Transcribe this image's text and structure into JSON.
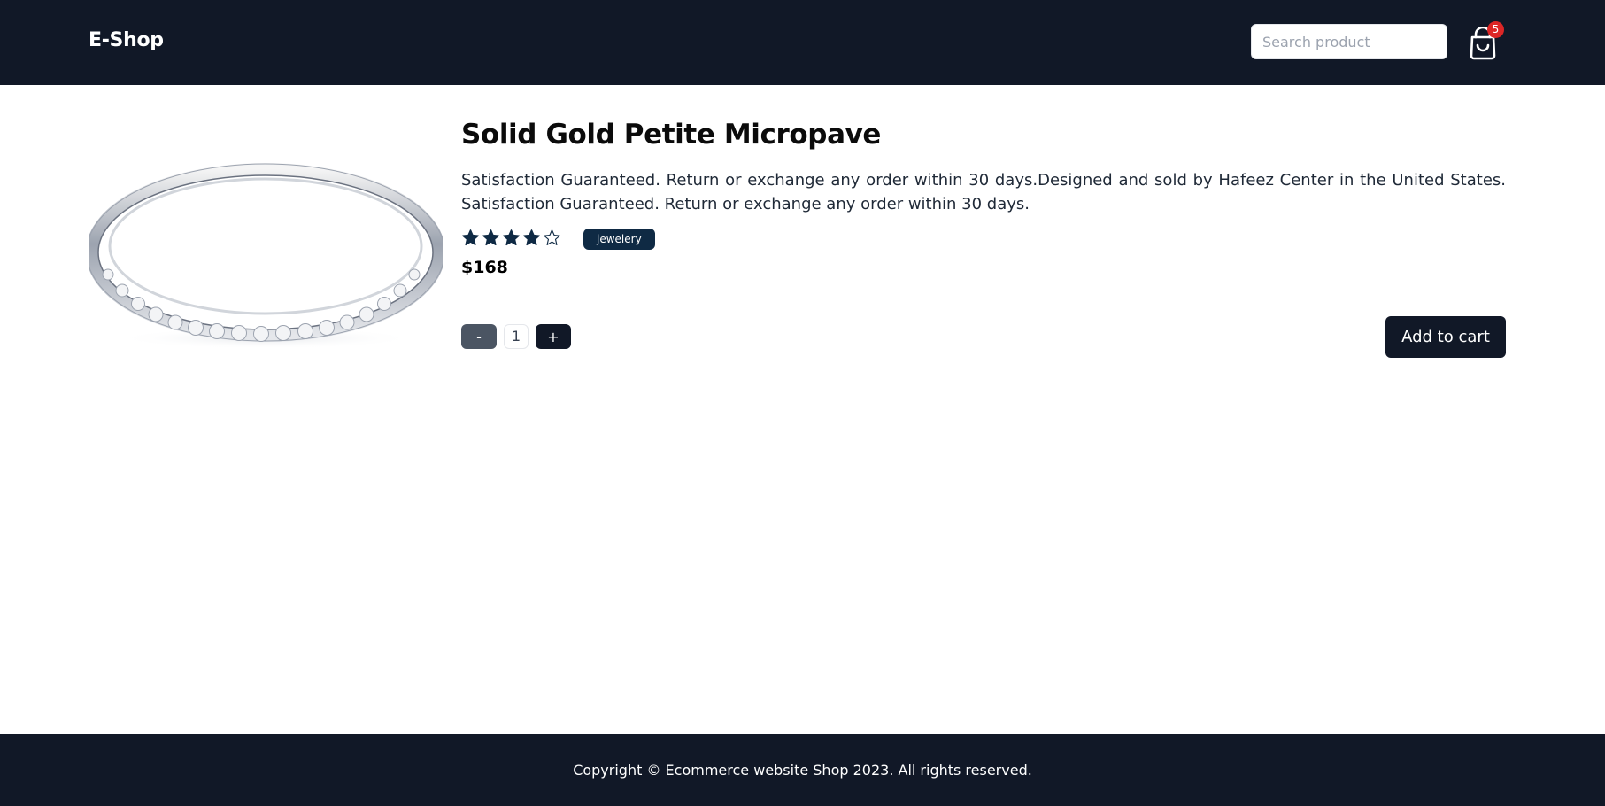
{
  "header": {
    "logo": "E-Shop",
    "search_placeholder": "Search product",
    "cart_count": "5",
    "cart_icon": "shopping-bag-icon"
  },
  "product": {
    "title": "Solid Gold Petite Micropave",
    "description": "Satisfaction Guaranteed. Return or exchange any order within 30 days.Designed and sold by Hafeez Center in the United States. Satisfaction Guaranteed. Return or exchange any order within 30 days.",
    "rating": {
      "filled": 4,
      "total": 5,
      "star_color": "#0f2a44"
    },
    "category": "jewelery",
    "price": "$168",
    "image_alt": "silver ring with small diamonds"
  },
  "quantity": {
    "minus_label": "-",
    "value": "1",
    "plus_label": "+"
  },
  "actions": {
    "add_to_cart_label": "Add to cart"
  },
  "footer": {
    "copyright": "Copyright © Ecommerce website Shop 2023. All rights reserved."
  },
  "colors": {
    "header_bg": "#111827",
    "badge_red": "#dc2626",
    "tag_bg": "#0f2a44"
  }
}
